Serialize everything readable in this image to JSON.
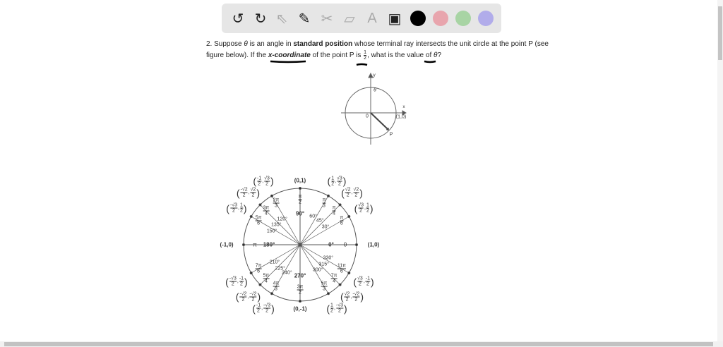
{
  "toolbar": {
    "tools": [
      {
        "name": "undo-icon",
        "glyph": "↺"
      },
      {
        "name": "redo-icon",
        "glyph": "↻"
      },
      {
        "name": "pointer-icon",
        "glyph": "⇖"
      },
      {
        "name": "pen-icon",
        "glyph": "✎"
      },
      {
        "name": "tools-icon",
        "glyph": "✂"
      },
      {
        "name": "eraser-icon",
        "glyph": "▱"
      },
      {
        "name": "text-icon",
        "glyph": "A"
      },
      {
        "name": "image-icon",
        "glyph": "▣"
      }
    ],
    "colors": [
      "#000000",
      "#e8a5ad",
      "#a8d4a4",
      "#b1acea"
    ]
  },
  "question": {
    "p1": "2. Suppose ",
    "theta": "θ",
    "p2": " is an angle in ",
    "b1": "standard position",
    "p3": " whose terminal ray intersects the unit circle at the point P (see",
    "l2a": "figure below).  If the ",
    "b2": "x-coordinate",
    "l2b": " of the point P is ",
    "num": "1",
    "den": "2",
    "l2c": ", what is the value of ",
    "l2d": "?"
  },
  "small_figure": {
    "y": "y",
    "x": "x",
    "theta": "θ",
    "origin": "0",
    "point": "(1,0)",
    "P": "P"
  },
  "unit_circle": {
    "axes": [
      {
        "deg": 0,
        "deg_label": "0°",
        "rad": "0",
        "coord": "(1,0)"
      },
      {
        "deg": 90,
        "deg_label": "90°",
        "rad_num": "π",
        "rad_den": "2",
        "coord": "(0,1)"
      },
      {
        "deg": 180,
        "deg_label": "180°",
        "rad": "π",
        "coord": "(-1,0)"
      },
      {
        "deg": 270,
        "deg_label": "270°",
        "rad_num": "3π",
        "rad_den": "2",
        "coord": "(0,-1)"
      }
    ],
    "angles": [
      {
        "deg": 30,
        "deg_label": "30°",
        "rad_num": "π",
        "rad_den": "6",
        "x": [
          "√3",
          "2"
        ],
        "y": [
          "1",
          "2"
        ]
      },
      {
        "deg": 45,
        "deg_label": "45°",
        "rad_num": "π",
        "rad_den": "4",
        "x": [
          "√2",
          "2"
        ],
        "y": [
          "√2",
          "2"
        ]
      },
      {
        "deg": 60,
        "deg_label": "60°",
        "rad_num": "π",
        "rad_den": "3",
        "x": [
          "1",
          "2"
        ],
        "y": [
          "√3",
          "2"
        ]
      },
      {
        "deg": 120,
        "deg_label": "120°",
        "rad_num": "2π",
        "rad_den": "3",
        "x": [
          "-1",
          "2"
        ],
        "y": [
          "√3",
          "2"
        ]
      },
      {
        "deg": 135,
        "deg_label": "135°",
        "rad_num": "3π",
        "rad_den": "4",
        "x": [
          "-√2",
          "2"
        ],
        "y": [
          "√2",
          "2"
        ]
      },
      {
        "deg": 150,
        "deg_label": "150°",
        "rad_num": "5π",
        "rad_den": "6",
        "x": [
          "-√3",
          "2"
        ],
        "y": [
          "1",
          "2"
        ]
      },
      {
        "deg": 210,
        "deg_label": "210°",
        "rad_num": "7π",
        "rad_den": "6",
        "x": [
          "-√3",
          "2"
        ],
        "y": [
          "-1",
          "2"
        ]
      },
      {
        "deg": 225,
        "deg_label": "225°",
        "rad_num": "5π",
        "rad_den": "4",
        "x": [
          "-√2",
          "2"
        ],
        "y": [
          "-√2",
          "2"
        ]
      },
      {
        "deg": 240,
        "deg_label": "240°",
        "rad_num": "4π",
        "rad_den": "3",
        "x": [
          "-1",
          "2"
        ],
        "y": [
          "-√3",
          "2"
        ]
      },
      {
        "deg": 300,
        "deg_label": "300°",
        "rad_num": "5π",
        "rad_den": "3",
        "x": [
          "1",
          "2"
        ],
        "y": [
          "-√3",
          "2"
        ]
      },
      {
        "deg": 315,
        "deg_label": "315°",
        "rad_num": "7π",
        "rad_den": "4",
        "x": [
          "√2",
          "2"
        ],
        "y": [
          "-√2",
          "2"
        ]
      },
      {
        "deg": 330,
        "deg_label": "330°",
        "rad_num": "11π",
        "rad_den": "6",
        "x": [
          "√3",
          "2"
        ],
        "y": [
          "-1",
          "2"
        ]
      }
    ]
  }
}
